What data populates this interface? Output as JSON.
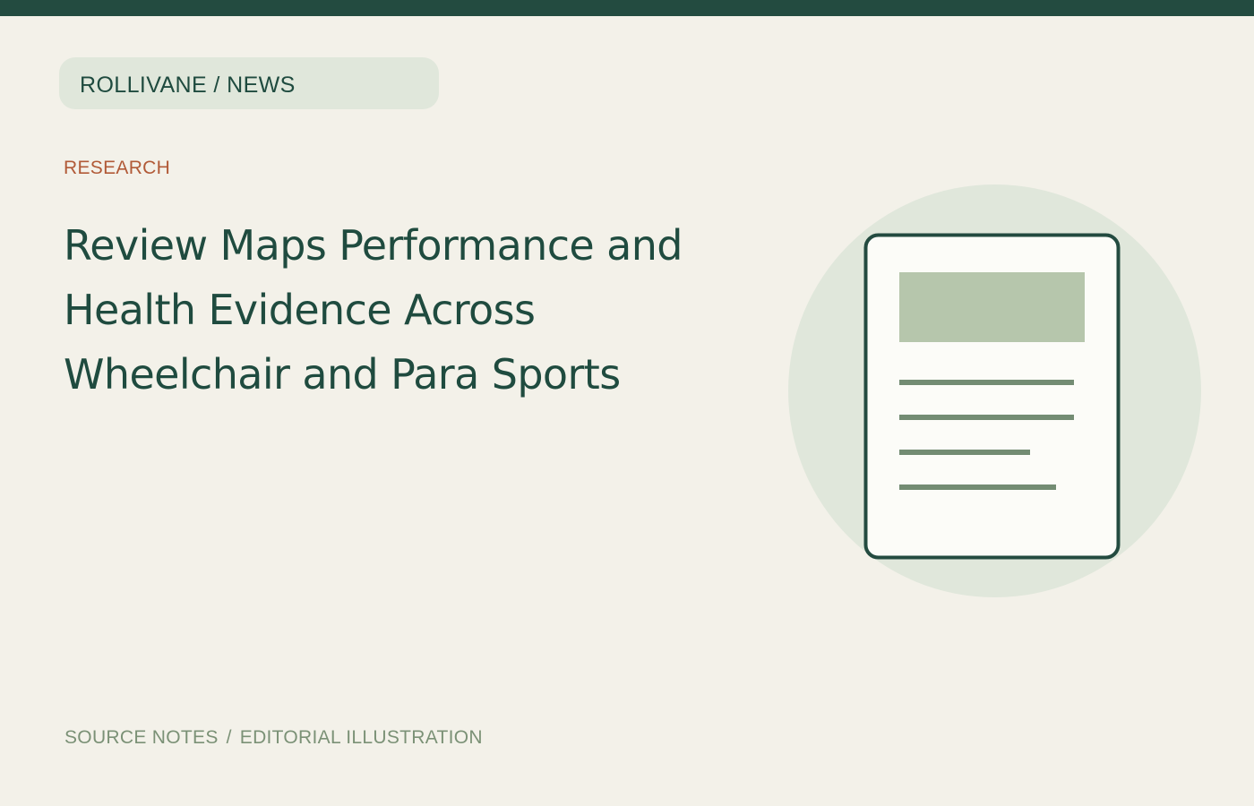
{
  "header": {
    "breadcrumb": "ROLLIVANE / NEWS"
  },
  "article": {
    "category": "RESEARCH",
    "title": "Review Maps Performance and Health Evidence Across Wheelchair and Para Sports"
  },
  "footer": {
    "source": "SOURCE NOTES",
    "separator": "/",
    "credit": "EDITORIAL ILLUSTRATION"
  },
  "illustration": {
    "icon": "document-icon"
  },
  "colors": {
    "brand": "#234b40",
    "accent": "#b15a37",
    "background": "#f3f1e9",
    "pill": "#e0e7db",
    "muted": "#7b9176"
  }
}
